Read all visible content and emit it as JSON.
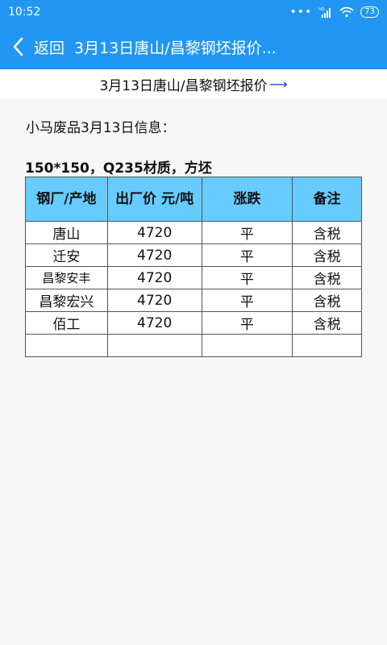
{
  "status": {
    "time": "10:52",
    "battery": "73",
    "network": "HD"
  },
  "appbar": {
    "back_label": "返回",
    "title": "3月13日唐山/昌黎钢坯报价..."
  },
  "article": {
    "title": "3月13日唐山/昌黎钢坯报价",
    "intro": "小马废品3月13日信息：",
    "spec": "150*150，Q235材质，方坯",
    "table": {
      "headers": [
        "钢厂/产地",
        "出厂价 元/吨",
        "涨跌",
        "备注"
      ],
      "rows": [
        [
          "唐山",
          "4720",
          "平",
          "含税"
        ],
        [
          "迁安",
          "4720",
          "平",
          "含税"
        ],
        [
          "昌黎安丰",
          "4720",
          "平",
          "含税"
        ],
        [
          "昌黎宏兴",
          "4720",
          "平",
          "含税"
        ],
        [
          "佰工",
          "4720",
          "平",
          "含税"
        ],
        [
          "",
          "",
          "",
          ""
        ]
      ]
    }
  },
  "colors": {
    "accent": "#2196f3",
    "table_header": "#66ccff",
    "arrow": "#1a3bd6"
  }
}
